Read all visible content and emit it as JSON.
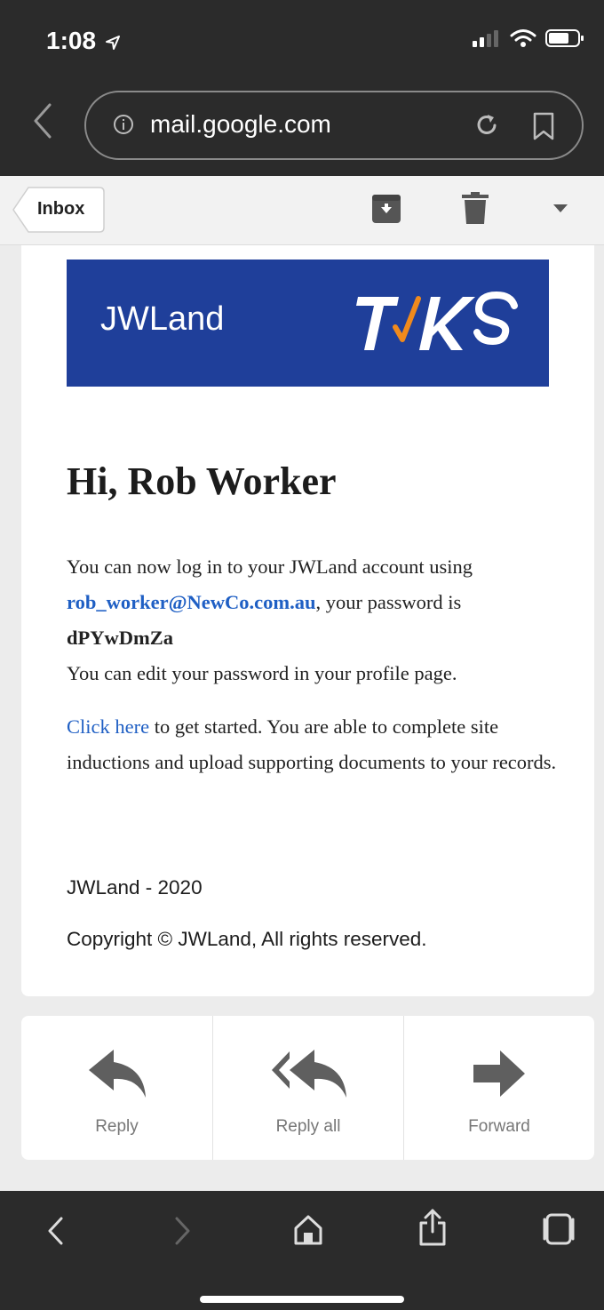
{
  "status": {
    "time": "1:08"
  },
  "browser": {
    "url": "mail.google.com"
  },
  "toolbar": {
    "inbox_label": "Inbox"
  },
  "email": {
    "banner_brand": "JWLand",
    "banner_logo": "TJKS",
    "greeting": "Hi, Rob Worker",
    "p1_intro": "You can now log in to your JWLand account using",
    "email_link": "rob_worker@NewCo.com.au",
    "p1_mid": ", your password is",
    "password": "dPYwDmZa",
    "p1_end": "You can edit your password in your profile page.",
    "p2_link": "Click here",
    "p2_rest": " to get started. You are able to complete site inductions and upload supporting documents to your records.",
    "footer_brand": "JWLand - 2020",
    "copyright": "Copyright © JWLand, All rights reserved.",
    "brand_color": "#1f3f9a",
    "link_color": "#1f5fc4"
  },
  "actions": {
    "reply": "Reply",
    "reply_all": "Reply all",
    "forward": "Forward"
  },
  "icons": [
    "location-arrow-icon",
    "signal-icon",
    "wifi-icon",
    "battery-icon",
    "back-chevron-icon",
    "info-icon",
    "reload-icon",
    "bookmark-icon",
    "archive-icon",
    "trash-icon",
    "dropdown-icon",
    "reply-icon",
    "reply-all-icon",
    "forward-icon",
    "nav-back-icon",
    "nav-forward-icon",
    "home-icon",
    "share-icon",
    "tabs-icon"
  ]
}
